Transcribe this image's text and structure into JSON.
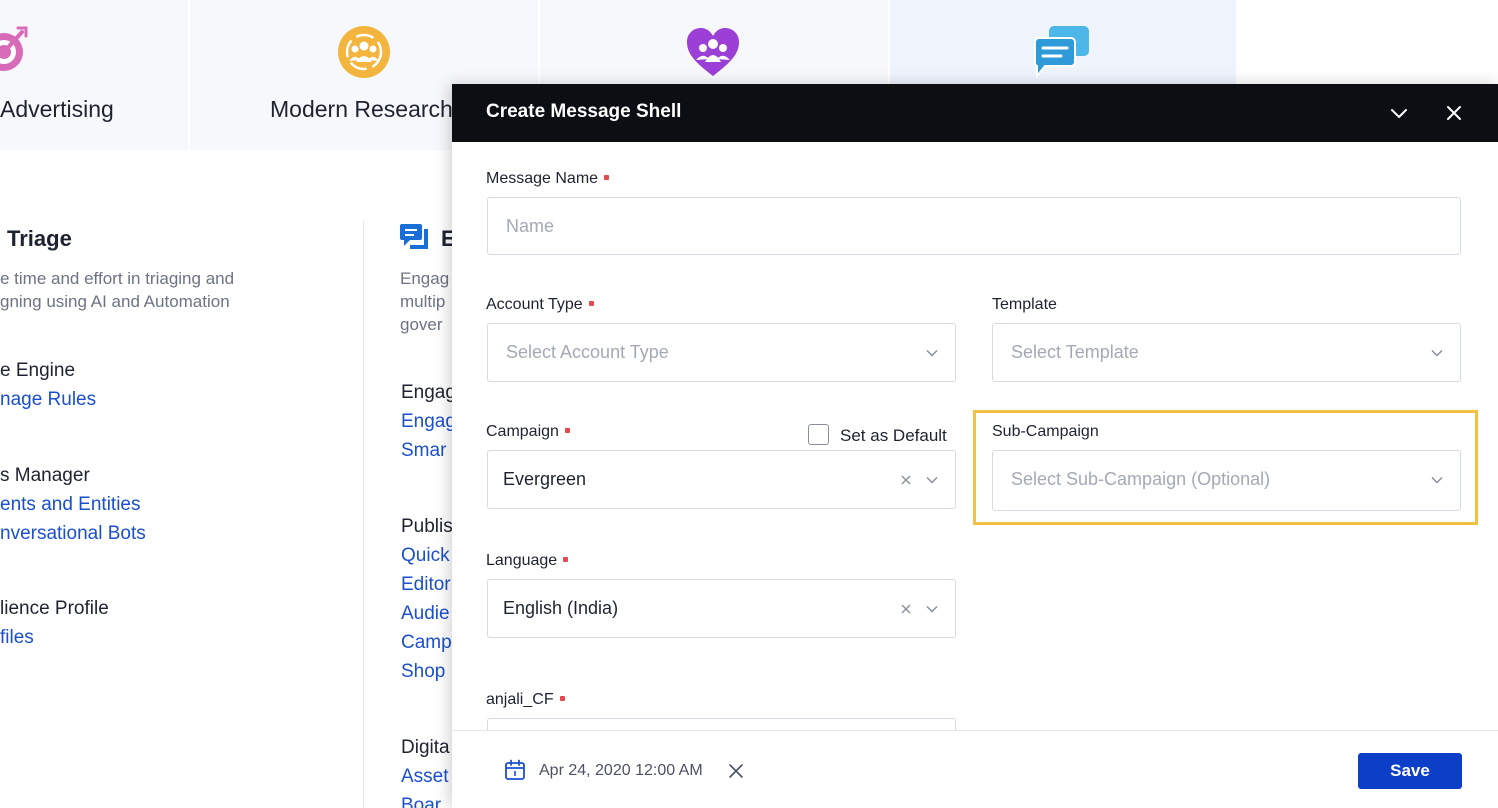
{
  "tiles": [
    {
      "label": "Advertising",
      "icon": "target-icon"
    },
    {
      "label": "Modern Research",
      "icon": "people-circle-icon"
    },
    {
      "label": "",
      "icon": "heart-people-icon"
    },
    {
      "label": "",
      "icon": "chat-bubbles-icon"
    }
  ],
  "left_panel": {
    "title": "Triage",
    "desc_line1": "e time and effort in triaging and",
    "desc_line2": "gning using AI and Automation",
    "sections": [
      {
        "heading": "e Engine",
        "links": [
          "nage Rules"
        ]
      },
      {
        "heading": "s Manager",
        "links": [
          "ents and Entities",
          "nversational Bots"
        ]
      },
      {
        "heading": "lience Profile",
        "links": [
          "files"
        ]
      }
    ]
  },
  "middle_panel": {
    "title": "E",
    "desc_line1": "Engag",
    "desc_line2": "multip",
    "desc_line3": "gover",
    "sections": [
      {
        "heading": "Engag",
        "links": [
          "Engag",
          "Smar"
        ]
      },
      {
        "heading": "Publis",
        "links": [
          "Quick",
          "Editor",
          "Audie",
          "Camp",
          "Shop"
        ]
      },
      {
        "heading": "Digita",
        "links": [
          "Asset",
          "Boar"
        ]
      }
    ]
  },
  "modal": {
    "title": "Create Message Shell",
    "fields": {
      "message_name": {
        "label": "Message Name",
        "placeholder": "Name",
        "value": ""
      },
      "account_type": {
        "label": "Account Type",
        "placeholder": "Select Account Type"
      },
      "template": {
        "label": "Template",
        "placeholder": "Select Template"
      },
      "campaign": {
        "label": "Campaign",
        "value": "Evergreen",
        "set_default_label": "Set as Default"
      },
      "sub_campaign": {
        "label": "Sub-Campaign",
        "placeholder": "Select Sub-Campaign (Optional)"
      },
      "language": {
        "label": "Language",
        "value": "English (India)"
      },
      "anjali_cf": {
        "label": "anjali_CF"
      }
    },
    "footer": {
      "date": "Apr 24, 2020 12:00 AM",
      "save_label": "Save"
    }
  },
  "colors": {
    "accent_blue": "#0c3ec8",
    "link_blue": "#1a4fcf",
    "required_red": "#e5484d",
    "highlight_yellow": "#f2c144",
    "header_dark": "#0c0e14"
  }
}
